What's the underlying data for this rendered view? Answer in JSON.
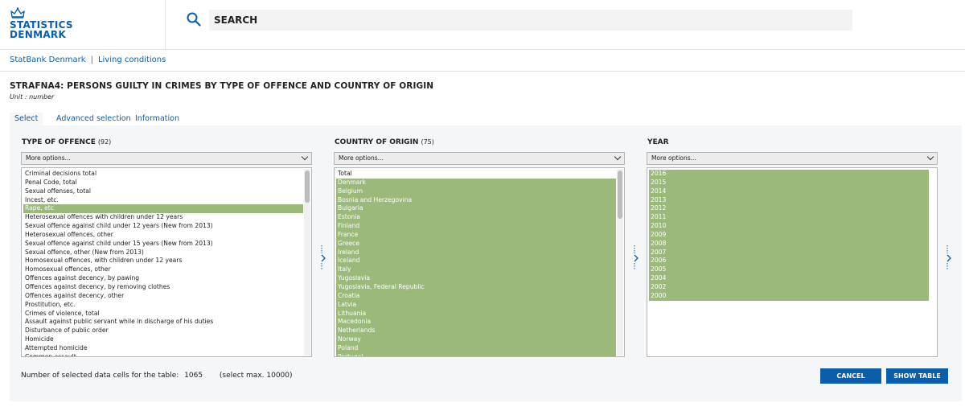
{
  "brand": {
    "name_line1": "STATISTICS",
    "name_line2": "DENMARK"
  },
  "search": {
    "placeholder": "SEARCH",
    "value": ""
  },
  "breadcrumb": [
    "StatBank Denmark",
    "Living conditions"
  ],
  "breadcrumb_separator": "|",
  "table": {
    "title": "STRAFNA4: PERSONS GUILTY IN CRIMES BY TYPE OF OFFENCE AND COUNTRY OF ORIGIN",
    "unit": "Unit : number"
  },
  "tabs": [
    {
      "label": "Select",
      "active": true
    },
    {
      "label": "Advanced selection",
      "active": false
    },
    {
      "label": "Information",
      "active": false
    }
  ],
  "selectors": [
    {
      "title": "TYPE OF OFFENCE",
      "count": "(92)",
      "dropdown": "More options...",
      "items": [
        {
          "label": "Criminal decisions total",
          "selected": false
        },
        {
          "label": "Penal Code, total",
          "selected": false
        },
        {
          "label": "Sexual offenses, total",
          "selected": false
        },
        {
          "label": "Incest, etc.",
          "selected": false
        },
        {
          "label": "Rape, etc",
          "selected": true
        },
        {
          "label": "Heterosexual offences with children under 12 years",
          "selected": false
        },
        {
          "label": "Sexual offence against child under 12 years (New from 2013)",
          "selected": false
        },
        {
          "label": "Heterosexual offences, other",
          "selected": false
        },
        {
          "label": "Sexual offence against child under 15 years (New from 2013)",
          "selected": false
        },
        {
          "label": "Sexual offence, other (New from 2013)",
          "selected": false
        },
        {
          "label": "Homosexual offences, with children under 12 years",
          "selected": false
        },
        {
          "label": "Homosexual offences, other",
          "selected": false
        },
        {
          "label": "Offences against decency, by pawing",
          "selected": false
        },
        {
          "label": "Offences against decency, by removing clothes",
          "selected": false
        },
        {
          "label": "Offences against decency, other",
          "selected": false
        },
        {
          "label": "Prostitution, etc.",
          "selected": false
        },
        {
          "label": "Crimes of violence, total",
          "selected": false
        },
        {
          "label": "Assault against public servant while in discharge of his duties",
          "selected": false
        },
        {
          "label": "Disturbance of public order",
          "selected": false
        },
        {
          "label": "Homicide",
          "selected": false
        },
        {
          "label": "Attempted homicide",
          "selected": false
        },
        {
          "label": "Common assault",
          "selected": false
        }
      ]
    },
    {
      "title": "COUNTRY OF ORIGIN",
      "count": "(75)",
      "dropdown": "More options...",
      "items": [
        {
          "label": "Total",
          "selected": false
        },
        {
          "label": "Denmark",
          "selected": true
        },
        {
          "label": "Belgium",
          "selected": true
        },
        {
          "label": "Bosnia and Herzegovina",
          "selected": true
        },
        {
          "label": "Bulgaria",
          "selected": true
        },
        {
          "label": "Estonia",
          "selected": true
        },
        {
          "label": "Finland",
          "selected": true
        },
        {
          "label": "France",
          "selected": true
        },
        {
          "label": "Greece",
          "selected": true
        },
        {
          "label": "Ireland",
          "selected": true
        },
        {
          "label": "Iceland",
          "selected": true
        },
        {
          "label": "Italy",
          "selected": true
        },
        {
          "label": "Yugoslavia",
          "selected": true
        },
        {
          "label": "Yugoslavia, Federal Republic",
          "selected": true
        },
        {
          "label": "Croatia",
          "selected": true
        },
        {
          "label": "Latvia",
          "selected": true
        },
        {
          "label": "Lithuania",
          "selected": true
        },
        {
          "label": "Macedonia",
          "selected": true
        },
        {
          "label": "Netherlands",
          "selected": true
        },
        {
          "label": "Norway",
          "selected": true
        },
        {
          "label": "Poland",
          "selected": true
        },
        {
          "label": "Portugal",
          "selected": true
        }
      ]
    },
    {
      "title": "YEAR",
      "count": "",
      "dropdown": "More options...",
      "items": [
        {
          "label": "2016",
          "selected": true
        },
        {
          "label": "2015",
          "selected": true
        },
        {
          "label": "2014",
          "selected": true
        },
        {
          "label": "2013",
          "selected": true
        },
        {
          "label": "2012",
          "selected": true
        },
        {
          "label": "2011",
          "selected": true
        },
        {
          "label": "2010",
          "selected": true
        },
        {
          "label": "2009",
          "selected": true
        },
        {
          "label": "2008",
          "selected": true
        },
        {
          "label": "2007",
          "selected": true
        },
        {
          "label": "2006",
          "selected": true
        },
        {
          "label": "2005",
          "selected": true
        },
        {
          "label": "2004",
          "selected": true
        },
        {
          "label": "2002",
          "selected": true
        },
        {
          "label": "2000",
          "selected": true
        }
      ]
    }
  ],
  "footer": {
    "cells_label": "Number of selected data cells for the table:",
    "cells_value": "1065",
    "max_note": "(select max. 10000)"
  },
  "buttons": {
    "cancel": "CANCEL",
    "show_table": "SHOW TABLE"
  },
  "colors": {
    "brand_blue": "#0d5ea8",
    "selected_green": "#9ab97a",
    "panel_bg": "#f4f6f8"
  },
  "icons": [
    "crown-icon",
    "search-icon",
    "chevron-down-icon",
    "chevron-right-icon"
  ]
}
